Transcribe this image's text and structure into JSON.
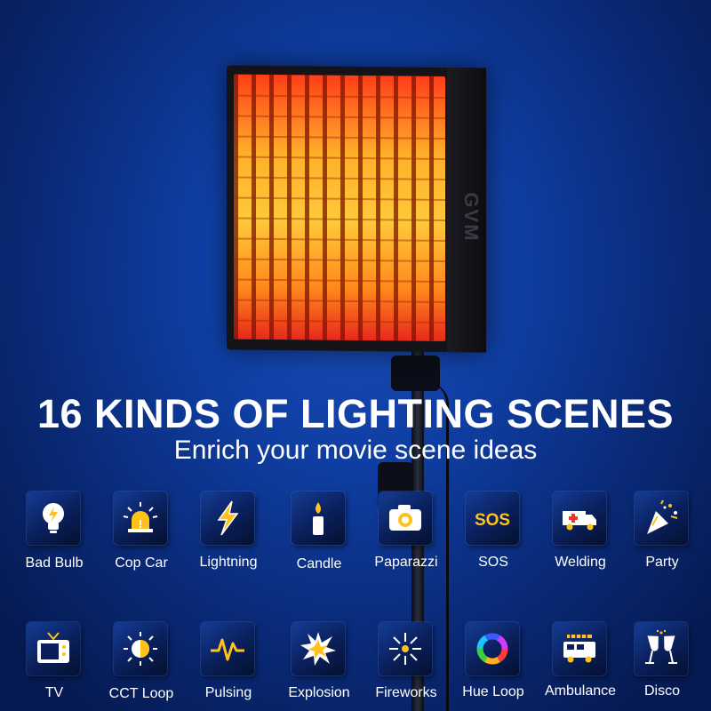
{
  "panel": {
    "brand": "GVM"
  },
  "headline": "16 KINDS OF LIGHTING SCENES",
  "subhead": "Enrich your movie scene ideas",
  "scenes_row1": [
    {
      "label": "Bad Bulb",
      "icon": "bulb-icon"
    },
    {
      "label": "Cop Car",
      "icon": "siren-icon"
    },
    {
      "label": "Lightning",
      "icon": "lightning-icon"
    },
    {
      "label": "Candle",
      "icon": "candle-icon"
    },
    {
      "label": "Paparazzi",
      "icon": "camera-icon"
    },
    {
      "label": "SOS",
      "icon": "sos-icon"
    },
    {
      "label": "Welding",
      "icon": "ambulance-van-icon"
    },
    {
      "label": "Party",
      "icon": "party-popper-icon"
    }
  ],
  "scenes_row2": [
    {
      "label": "TV",
      "icon": "tv-icon"
    },
    {
      "label": "CCT Loop",
      "icon": "sun-icon"
    },
    {
      "label": "Pulsing",
      "icon": "pulse-icon"
    },
    {
      "label": "Explosion",
      "icon": "explosion-icon"
    },
    {
      "label": "Fireworks",
      "icon": "firework-icon"
    },
    {
      "label": "Hue Loop",
      "icon": "color-ring-icon"
    },
    {
      "label": "Ambulance",
      "icon": "fire-truck-icon"
    },
    {
      "label": "Disco",
      "icon": "champagne-icon"
    }
  ],
  "sos_text": "SOS",
  "colors": {
    "accent": "#ffc21a",
    "background": "#0f3ea3"
  }
}
